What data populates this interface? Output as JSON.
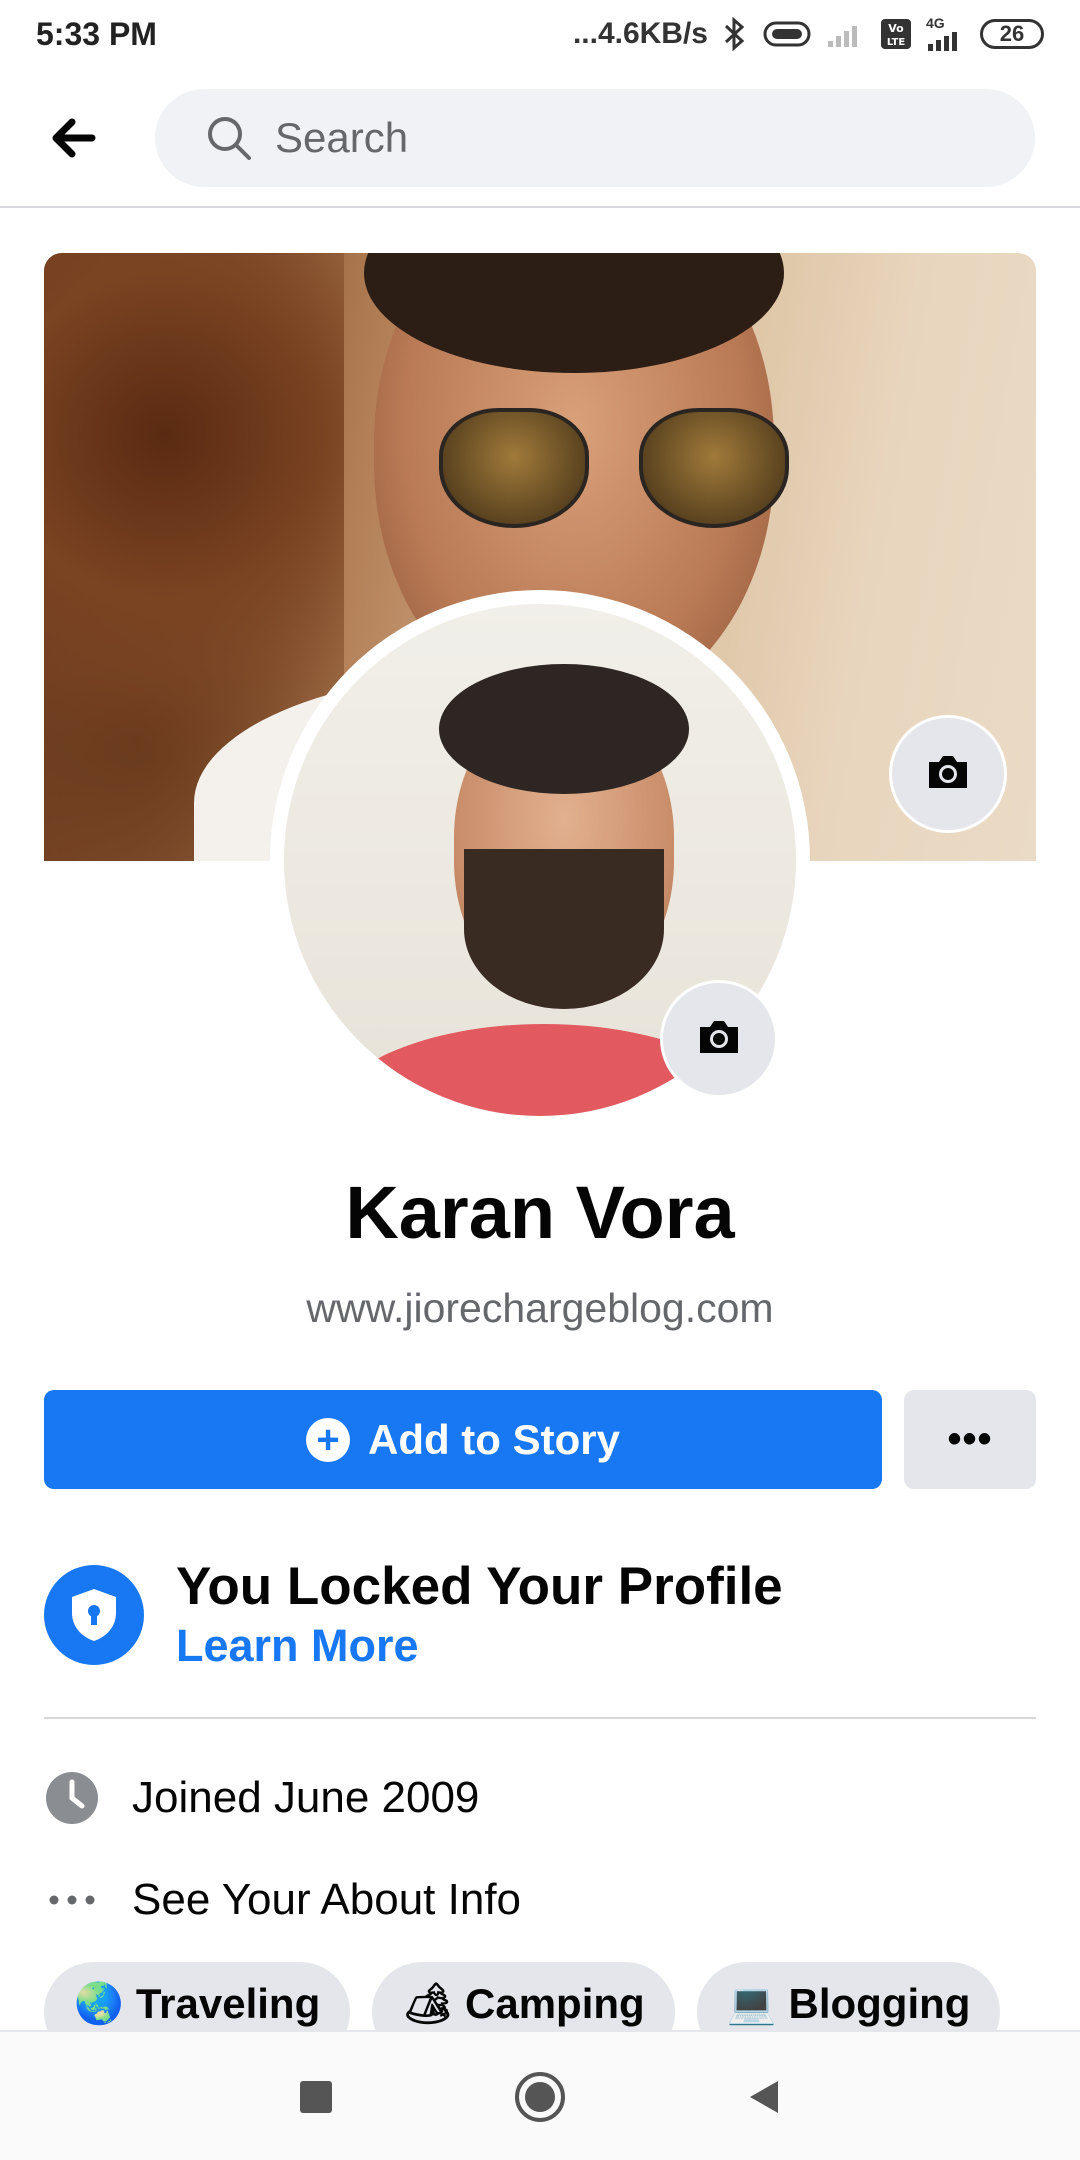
{
  "status_bar": {
    "time": "5:33 PM",
    "network_speed": "...4.6KB/s",
    "network_type": "4G",
    "battery": "26"
  },
  "header": {
    "search_placeholder": "Search"
  },
  "profile": {
    "name": "Karan Vora",
    "bio": "www.jiorechargeblog.com"
  },
  "actions": {
    "add_story_label": "Add to Story",
    "more_label": "•••"
  },
  "lock_notice": {
    "title": "You Locked Your Profile",
    "link": "Learn More"
  },
  "details": [
    {
      "icon": "clock-icon",
      "text": "Joined June 2009"
    },
    {
      "icon": "more-dots-icon",
      "text": "See Your About Info"
    }
  ],
  "hobbies": [
    {
      "emoji": "🌏",
      "label": "Traveling"
    },
    {
      "emoji": "🏕",
      "label": "Camping"
    },
    {
      "emoji": "💻",
      "label": "Blogging"
    }
  ],
  "colors": {
    "accent": "#1877f2",
    "button_bg": "#e4e6eb",
    "secondary_text": "#65676b"
  }
}
